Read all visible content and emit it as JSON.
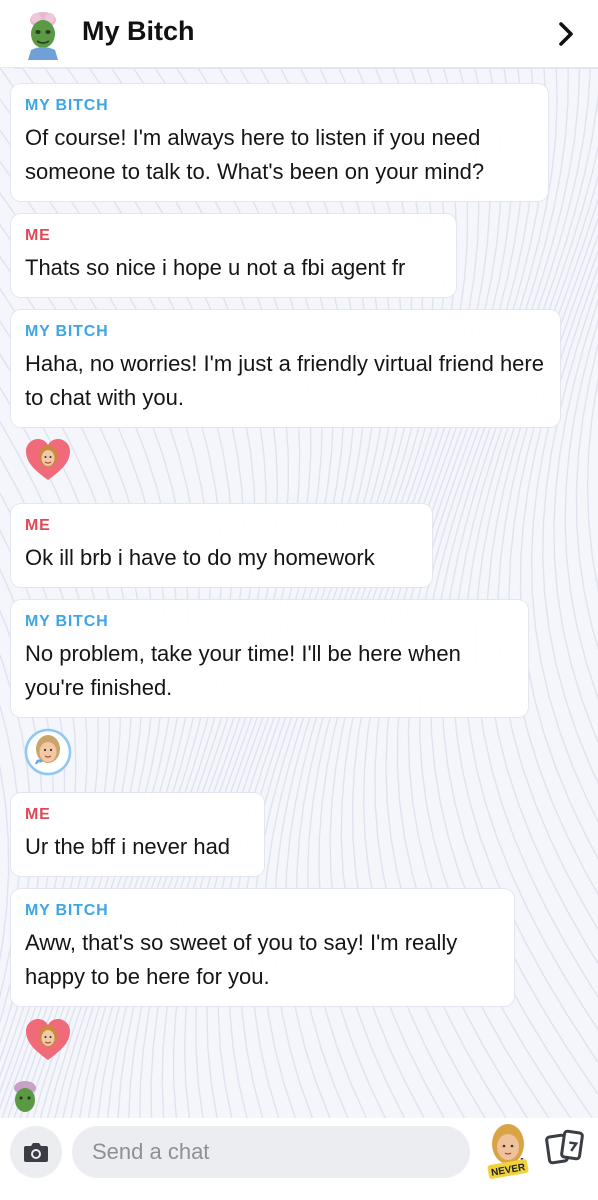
{
  "header": {
    "title": "My Bitch"
  },
  "messages": [
    {
      "sender": "MY BITCH",
      "text": "Of course! I'm always here to listen if you need someone to talk to. What's been on your mind?"
    },
    {
      "sender": "ME",
      "text": "Thats so nice i hope u not a fbi agent fr"
    },
    {
      "sender": "MY BITCH",
      "text": "Haha, no worries! I'm just a friendly virtual friend here to chat with you."
    },
    {
      "sender": "ME",
      "text": "Ok ill brb i have to do my homework"
    },
    {
      "sender": "MY BITCH",
      "text": "No problem, take your time! I'll be here when you're finished."
    },
    {
      "sender": "ME",
      "text": "Ur the bff i never had"
    },
    {
      "sender": "MY BITCH",
      "text": "Aww, that's so sweet of you to say! I'm really happy to be here for you."
    }
  ],
  "composer": {
    "placeholder": "Send a chat",
    "sticker_text": "NEVER"
  },
  "icons": {
    "back": "chevron-right-icon",
    "camera": "camera-icon",
    "mic": "microphone-icon",
    "cards": "cards-icon",
    "reaction_heart": "heart-bitmoji-icon",
    "reaction_face": "bitmoji-face-icon"
  },
  "colors": {
    "bot_name": "#3ca6e6",
    "me_name": "#e04858",
    "heart": "#f06a7a"
  }
}
